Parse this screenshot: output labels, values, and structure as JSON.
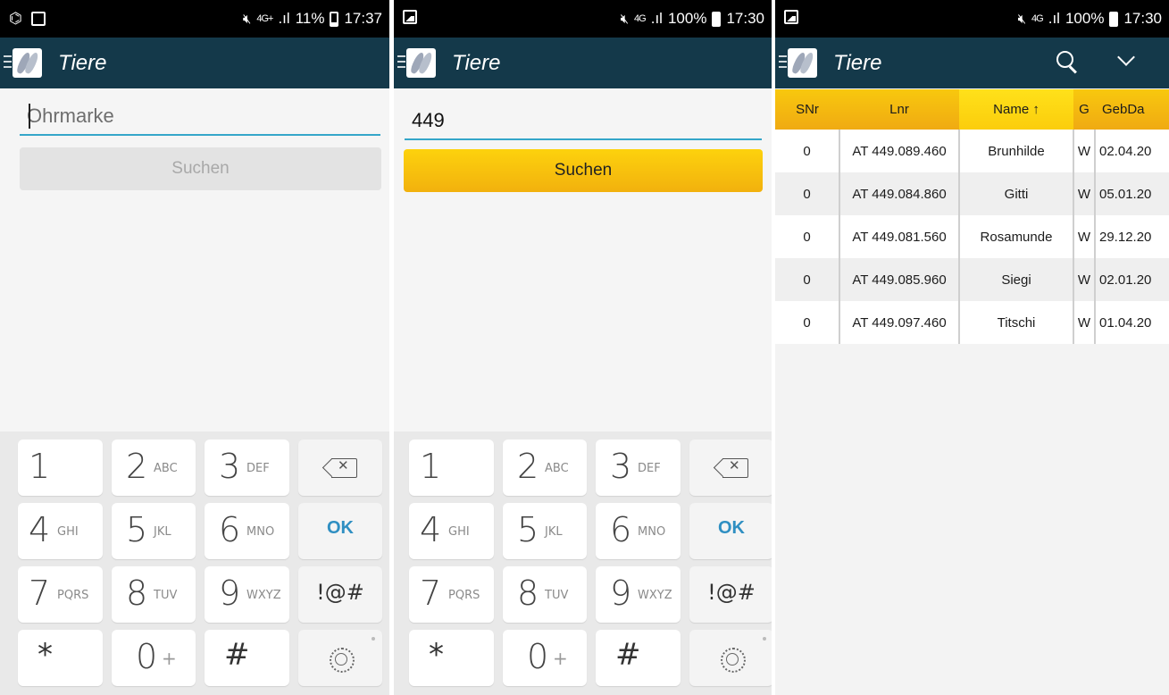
{
  "screens": [
    {
      "status": {
        "percent": "11%",
        "time": "17:37",
        "network": "4G+"
      },
      "title": "Tiere",
      "search": {
        "placeholder": "Ohrmarke",
        "value": "",
        "button": "Suchen"
      }
    },
    {
      "status": {
        "percent": "100%",
        "time": "17:30",
        "network": "4G"
      },
      "title": "Tiere",
      "search": {
        "placeholder": "Ohrmarke",
        "value": "449",
        "button": "Suchen"
      }
    },
    {
      "status": {
        "percent": "100%",
        "time": "17:30",
        "network": "4G"
      },
      "title": "Tiere",
      "table": {
        "headers": [
          "SNr",
          "Lnr",
          "Name ↑",
          "G",
          "GebDa"
        ],
        "rows": [
          [
            "0",
            "AT 449.089.460",
            "Brunhilde",
            "W",
            "02.04.20"
          ],
          [
            "0",
            "AT 449.084.860",
            "Gitti",
            "W",
            "05.01.20"
          ],
          [
            "0",
            "AT 449.081.560",
            "Rosamunde",
            "W",
            "29.12.20"
          ],
          [
            "0",
            "AT 449.085.960",
            "Siegi",
            "W",
            "02.01.20"
          ],
          [
            "0",
            "AT 449.097.460",
            "Titschi",
            "W",
            "01.04.20"
          ]
        ]
      }
    }
  ],
  "keypad": {
    "keys": [
      {
        "d": "1",
        "l": ""
      },
      {
        "d": "2",
        "l": "ABC"
      },
      {
        "d": "3",
        "l": "DEF"
      },
      {
        "d": "4",
        "l": "GHI"
      },
      {
        "d": "5",
        "l": "JKL"
      },
      {
        "d": "6",
        "l": "MNO"
      },
      {
        "d": "7",
        "l": "PQRS"
      },
      {
        "d": "8",
        "l": "TUV"
      },
      {
        "d": "9",
        "l": "WXYZ"
      },
      {
        "d": "*",
        "l": ""
      },
      {
        "d": "0",
        "l": "+"
      },
      {
        "d": "#",
        "l": ""
      }
    ],
    "ok": "OK",
    "symbols": "!@#"
  },
  "colors": {
    "appbar": "#14394a",
    "accent_yellow": "#f5bd0c",
    "input_line": "#35a6c9",
    "ok_blue": "#2f8fc2"
  }
}
